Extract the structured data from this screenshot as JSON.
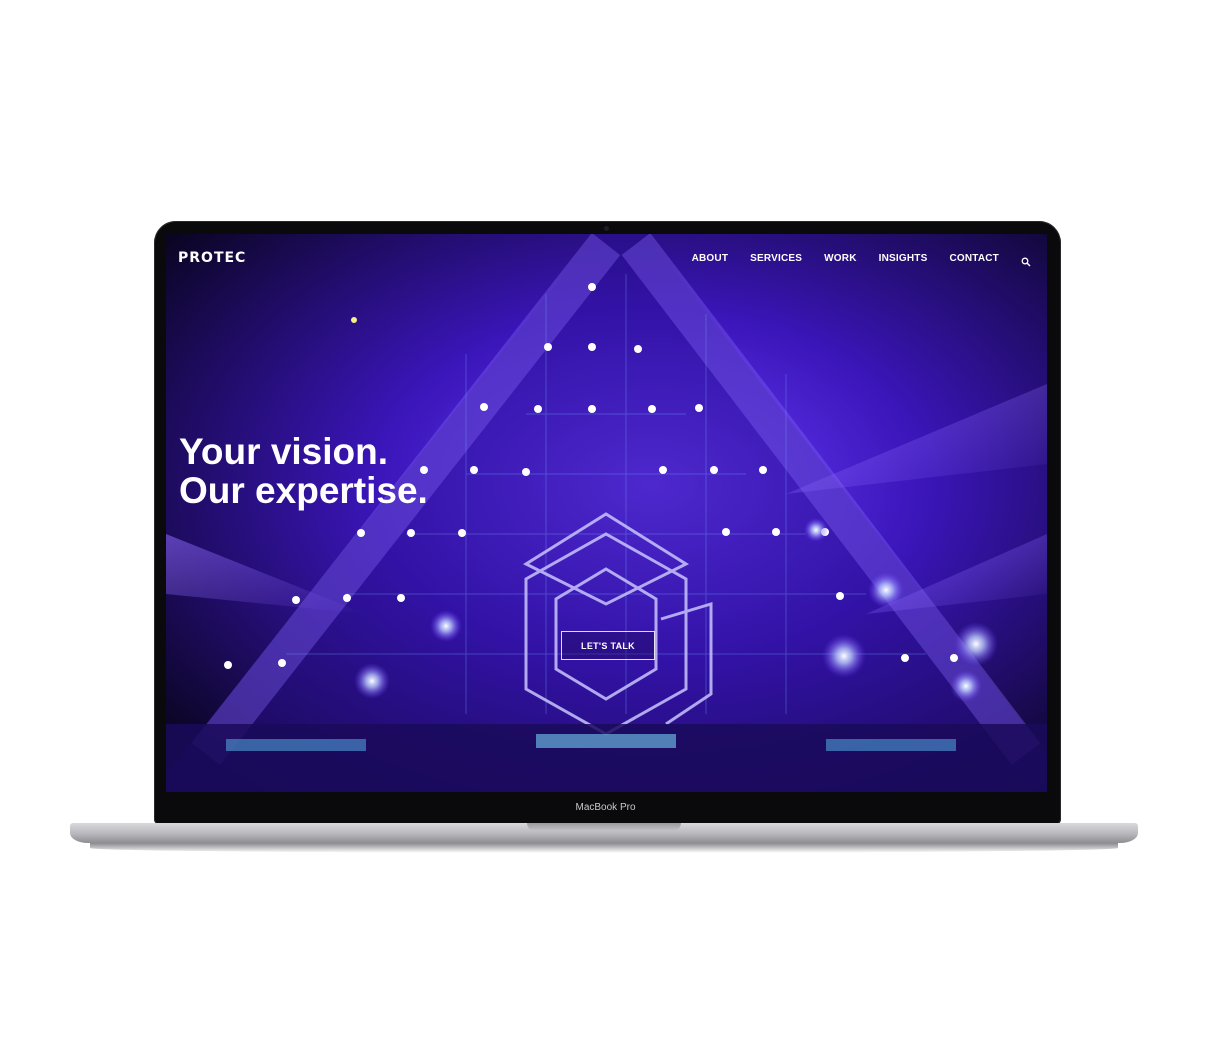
{
  "device": {
    "model_label": "MacBook Pro"
  },
  "site": {
    "logo": "PROTEC",
    "nav": {
      "items": [
        "ABOUT",
        "SERVICES",
        "WORK",
        "INSIGHTS",
        "CONTACT"
      ],
      "search_icon": "search-icon"
    },
    "hero": {
      "headline_line1": "Your vision.",
      "headline_line2": "Our expertise.",
      "cta_label": "LET'S TALK"
    }
  },
  "colors": {
    "hero_background": "#2a0f8a",
    "accent_purple": "#6a3cff",
    "text": "#ffffff"
  }
}
